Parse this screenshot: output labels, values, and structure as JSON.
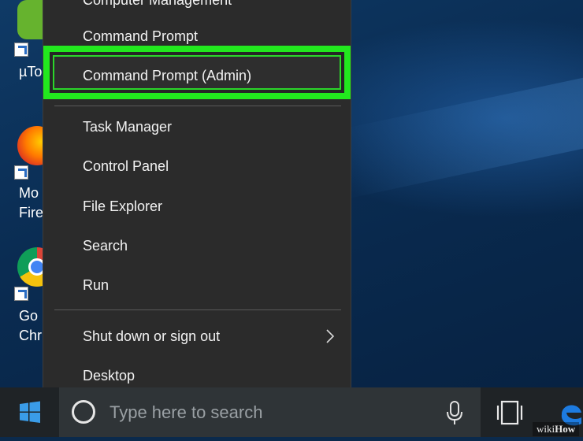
{
  "desktop": {
    "icons": [
      {
        "name": "uTorrent",
        "label": "µTo"
      },
      {
        "name": "Mozilla Firefox",
        "label_lines": [
          "Mo",
          "Fire"
        ]
      },
      {
        "name": "Google Chrome",
        "label_lines": [
          "Go",
          "Chr"
        ]
      }
    ]
  },
  "menu": {
    "partial_item": "Computer Management",
    "items": [
      {
        "label": "Command Prompt"
      },
      {
        "label": "Command Prompt (Admin)",
        "highlighted": true
      },
      {
        "label": "Task Manager"
      },
      {
        "label": "Control Panel"
      },
      {
        "label": "File Explorer"
      },
      {
        "label": "Search"
      },
      {
        "label": "Run"
      },
      {
        "label": "Shut down or sign out",
        "has_submenu": true
      },
      {
        "label": "Desktop"
      }
    ],
    "highlight_color": "#22e81e"
  },
  "taskbar": {
    "search_placeholder": "Type here to search",
    "icons": [
      "windows-logo-icon",
      "cortana-circle-icon",
      "microphone-icon",
      "task-view-icon",
      "edge-icon"
    ]
  },
  "watermark": {
    "prefix": "wiki",
    "suffix": "How"
  }
}
